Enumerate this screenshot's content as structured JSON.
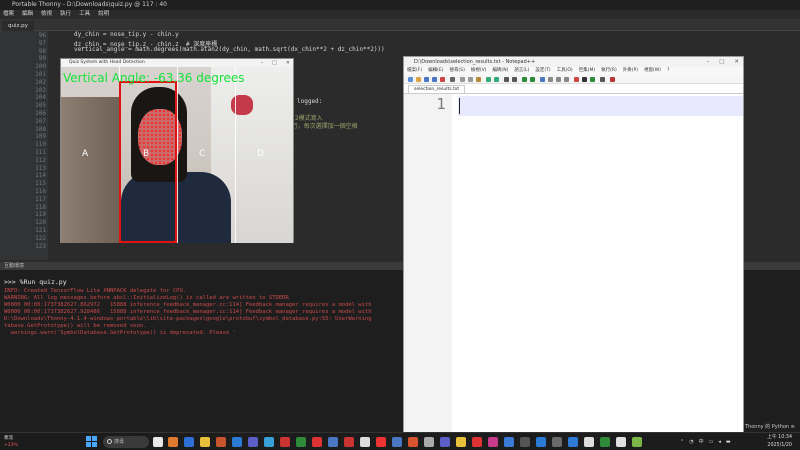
{
  "thonny": {
    "title": "Portable Thonny - D:\\Downloads\\quiz.py @ 117 : 40",
    "menu": [
      "檔案",
      "編輯",
      "檢視",
      "執行",
      "工具",
      "說明"
    ],
    "tab": "quiz.py",
    "line_numbers": [
      "96",
      "97",
      "98",
      "99",
      "100",
      "101",
      "102",
      "103",
      "104",
      "105",
      "106",
      "107",
      "108",
      "109",
      "110",
      "111",
      "112",
      "113",
      "114",
      "115",
      "116",
      "117",
      "118",
      "119",
      "120",
      "121",
      "122",
      "123"
    ],
    "code": [
      "dy_chin = nose_tip.y - chin.y",
      "dz_chin = nose_tip.z - chin.z  # 深度座標",
      "vertical_angle = math.degrees(math.atan2(dy_chin, math.sqrt(dx_chin**2 + dz_chin**2)))"
    ],
    "code_fragments": [
      "logged:",
      "2模式寫入",
      "5行，每次選擇加一個空格"
    ],
    "shell_bar": "互動環境",
    "shell_prompt": ">>> %Run quiz.py",
    "shell_lines": [
      "INFO: Created TensorFlow Lite XNNPACK delegate for CPU.",
      "WARNING: All log messages before absl::InitializeLog() is called are written to STDERR",
      "W0000 00:00:1737382627.862972   15888 inference_feedback_manager.cc:114] Feedback manager requires a model with",
      "W0000 00:00:1737382627.928486   15888 inference_feedback_manager.cc:114] Feedback manager requires a model with",
      "D:\\Downloads\\Thonny-4.1.4-windows-portable\\lib\\site-packages\\google\\protobuf\\symbol_database.py:55: UserWarning",
      "tabase.GetPrototype() will be removed soon.",
      "  warnings.warn('SymbolDatabase.GetPrototype() is deprecated. Please '"
    ],
    "status": "Thonny 的 Python ≡"
  },
  "camera": {
    "title": "Quiz System with Head Detection",
    "angle_text": "Vertical Angle: -63.36 degrees",
    "zones": [
      "A",
      "B",
      "C",
      "D"
    ],
    "accent_green": "#17e23a",
    "box_red": "#e01212"
  },
  "notepad": {
    "title": "D:\\Downloads\\selection_results.txt - Notepad++",
    "menu": [
      "檔案(F)",
      "編輯(E)",
      "搜尋(S)",
      "檢視(V)",
      "編碼(N)",
      "語言(L)",
      "設定(T)",
      "工具(O)",
      "巨集(M)",
      "執行(R)",
      "外掛(P)",
      "視窗(W)",
      "?"
    ],
    "tab": "selection_results.txt",
    "line_number": "1"
  },
  "taskbar": {
    "weather_label": "寒流",
    "weather_value": "+23%",
    "search_placeholder": "搜尋",
    "time": "上午 10:34",
    "date": "2025/1/20",
    "tray_lang": "中"
  }
}
